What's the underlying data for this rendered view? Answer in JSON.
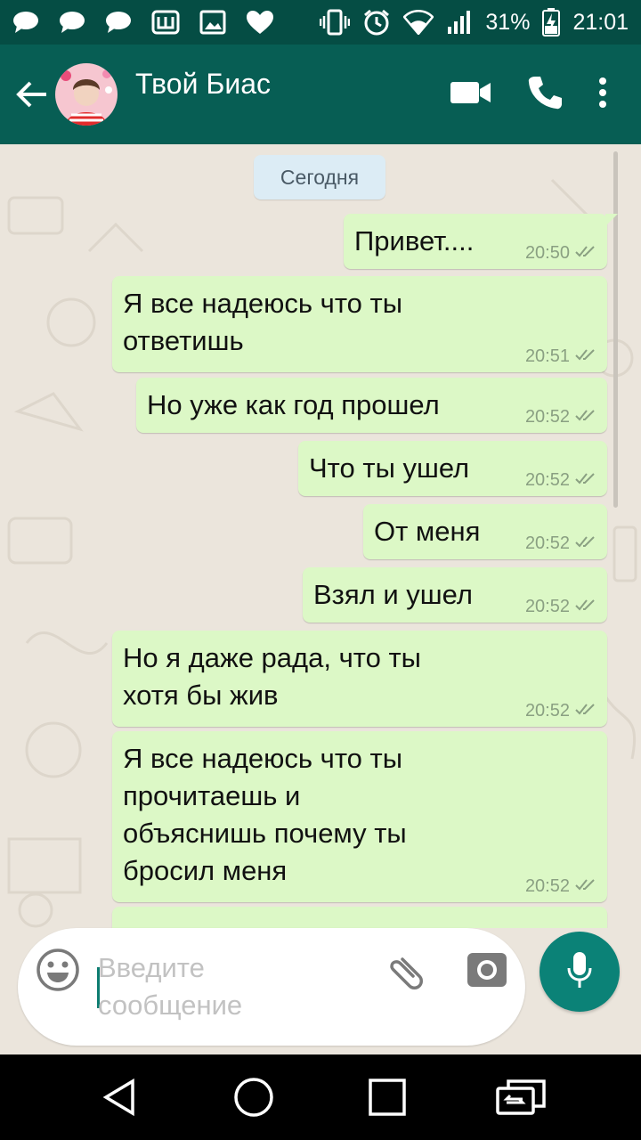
{
  "status_bar": {
    "battery_percent": "31%",
    "time": "21:01",
    "left_icons": [
      "chat-bubble-icon",
      "chat-bubble-icon",
      "chat-bubble-icon",
      "app-w-icon",
      "image-icon",
      "heart-icon"
    ],
    "right_icons": [
      "vibrate-icon",
      "alarm-icon",
      "wifi-icon",
      "signal-icon",
      "battery-charging-icon"
    ]
  },
  "toolbar": {
    "contact_name": "Твой Биас",
    "actions": [
      "video-call-icon",
      "voice-call-icon",
      "more-vert-icon"
    ]
  },
  "chat": {
    "date_chip": "Сегодня",
    "messages": [
      {
        "text": "Привет....",
        "time": "20:50"
      },
      {
        "text": "Я все надеюсь что ты\nответишь",
        "time": "20:51"
      },
      {
        "text": "Но уже как год прошел",
        "time": "20:52"
      },
      {
        "text": "Что ты ушел",
        "time": "20:52"
      },
      {
        "text": "От меня",
        "time": "20:52"
      },
      {
        "text": "Взял и ушел",
        "time": "20:52"
      },
      {
        "text": "Но я даже рада, что ты\nхотя бы жив",
        "time": "20:52"
      },
      {
        "text": "Я все надеюсь что ты\nпрочитаешь и\nобъяснишь почему ты\nбросил меня",
        "time": "20:52"
      },
      {
        "text": "",
        "time": ""
      }
    ]
  },
  "input": {
    "placeholder": "Введите\nсообщение",
    "value": ""
  },
  "colors": {
    "status_bar": "#054d44",
    "toolbar": "#075e54",
    "outgoing_bubble": "#dcf8c6",
    "mic_button": "#0b8277",
    "date_chip": "#dcecf5"
  }
}
